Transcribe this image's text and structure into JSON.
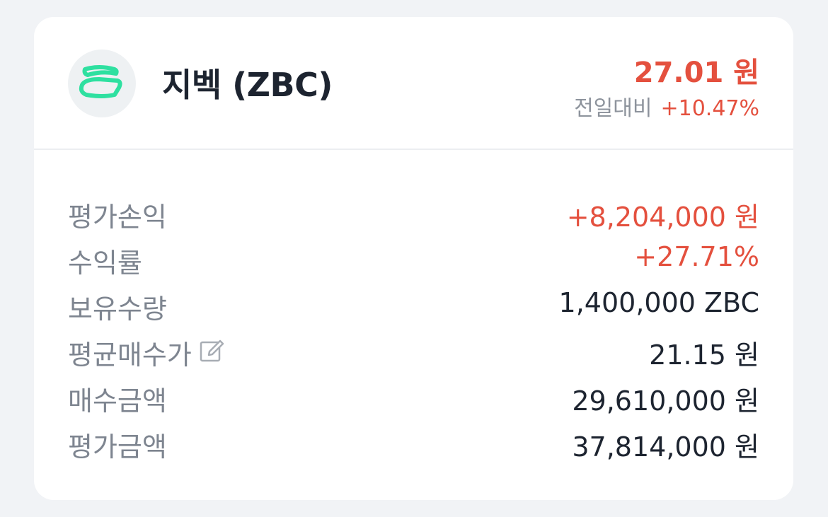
{
  "coin": {
    "logo_icon": "zbc-logo-icon",
    "name": "지벡 (ZBC)",
    "price": "27.01 원",
    "change_label": "전일대비",
    "change_value": "+10.47%"
  },
  "details": [
    {
      "label": "평가손익",
      "value": "+8,204,000 원",
      "highlight": true
    },
    {
      "label": "수익률",
      "value": "+27.71%",
      "highlight": true
    },
    {
      "label": "보유수량",
      "value": "1,400,000 ZBC",
      "highlight": false
    },
    {
      "label": "평균매수가",
      "value": "21.15 원",
      "highlight": false,
      "icon": "edit-icon"
    },
    {
      "label": "매수금액",
      "value": "29,610,000 원",
      "highlight": false
    },
    {
      "label": "평가금액",
      "value": "37,814,000 원",
      "highlight": false
    }
  ],
  "colors": {
    "positive": "#e4503e",
    "logo_accent": "#2ee0a0",
    "label": "#7e8590",
    "value": "#1d2430"
  }
}
